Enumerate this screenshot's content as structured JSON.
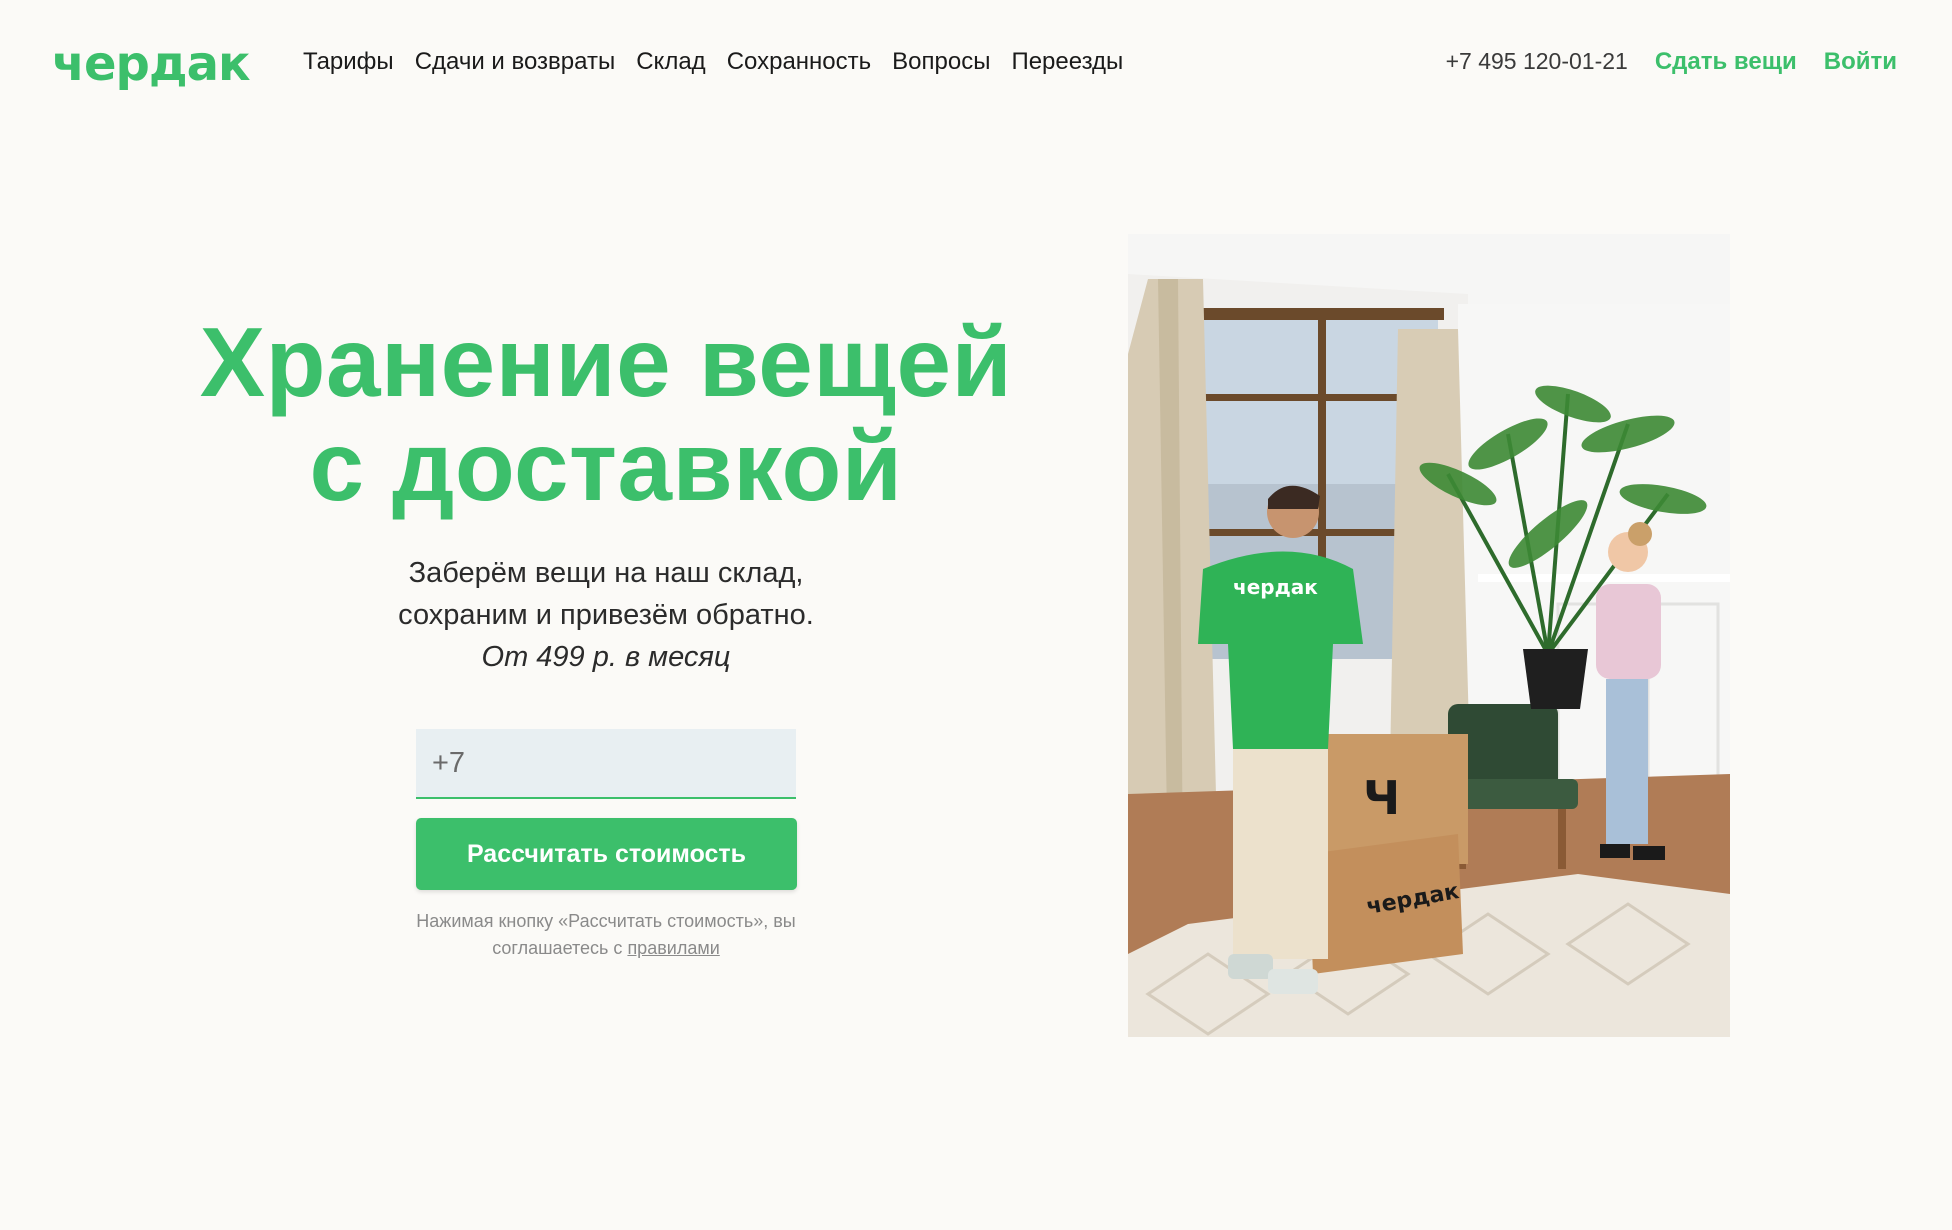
{
  "brand": {
    "logo_text": "чердак",
    "accent": "#3cbf6b"
  },
  "nav": {
    "items": [
      {
        "label": "Тарифы"
      },
      {
        "label": "Сдачи и возвраты"
      },
      {
        "label": "Склад"
      },
      {
        "label": "Сохранность"
      },
      {
        "label": "Вопросы"
      },
      {
        "label": "Переезды"
      }
    ]
  },
  "header_right": {
    "phone": "+7 495 120-01-21",
    "give_label": "Сдать вещи",
    "login_label": "Войти"
  },
  "hero": {
    "title_line1": "Хранение вещей",
    "title_line2": "с доставкой",
    "sub_line1": "Заберём вещи на наш склад,",
    "sub_line2": "сохраним и привезём обратно.",
    "price_line": "От 499 р. в месяц"
  },
  "form": {
    "phone_placeholder": "+7",
    "submit_label": "Рассчитать стоимость",
    "agree_text": "Нажимая кнопку «Рассчитать стоимость», вы соглашаетесь с",
    "agree_link": "правилами"
  },
  "photo": {
    "shirt_text": "чердак",
    "box_top_letter": "Ч",
    "box_bottom_text": "чердак"
  }
}
